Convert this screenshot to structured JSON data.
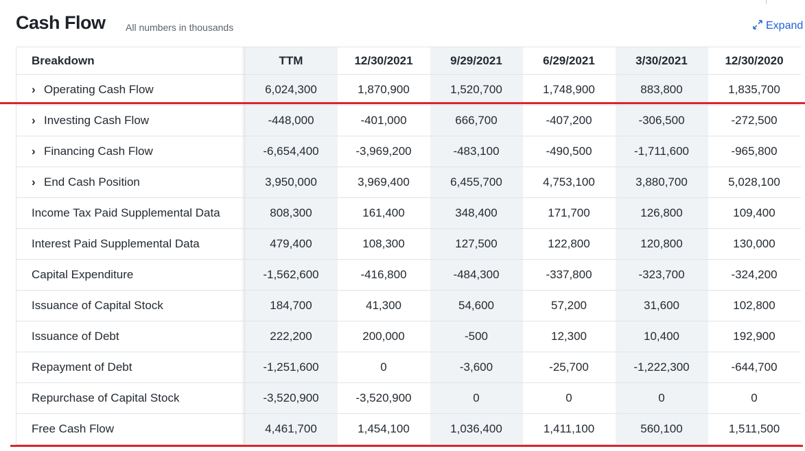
{
  "header": {
    "title": "Cash Flow",
    "subtitle": "All numbers in thousands",
    "expand_label": "Expand"
  },
  "colors": {
    "accent": "#1d5fd6",
    "highlight_line": "#d9262f",
    "shaded_column": "#f0f3f5"
  },
  "table": {
    "columns": [
      "Breakdown",
      "TTM",
      "12/30/2021",
      "9/29/2021",
      "6/29/2021",
      "3/30/2021",
      "12/30/2020"
    ],
    "rows": [
      {
        "label": "Operating Cash Flow",
        "expandable": true,
        "values": [
          "6,024,300",
          "1,870,900",
          "1,520,700",
          "1,748,900",
          "883,800",
          "1,835,700"
        ]
      },
      {
        "label": "Investing Cash Flow",
        "expandable": true,
        "values": [
          "-448,000",
          "-401,000",
          "666,700",
          "-407,200",
          "-306,500",
          "-272,500"
        ]
      },
      {
        "label": "Financing Cash Flow",
        "expandable": true,
        "values": [
          "-6,654,400",
          "-3,969,200",
          "-483,100",
          "-490,500",
          "-1,711,600",
          "-965,800"
        ]
      },
      {
        "label": "End Cash Position",
        "expandable": true,
        "values": [
          "3,950,000",
          "3,969,400",
          "6,455,700",
          "4,753,100",
          "3,880,700",
          "5,028,100"
        ]
      },
      {
        "label": "Income Tax Paid Supplemental Data",
        "expandable": false,
        "values": [
          "808,300",
          "161,400",
          "348,400",
          "171,700",
          "126,800",
          "109,400"
        ]
      },
      {
        "label": "Interest Paid Supplemental Data",
        "expandable": false,
        "values": [
          "479,400",
          "108,300",
          "127,500",
          "122,800",
          "120,800",
          "130,000"
        ]
      },
      {
        "label": "Capital Expenditure",
        "expandable": false,
        "values": [
          "-1,562,600",
          "-416,800",
          "-484,300",
          "-337,800",
          "-323,700",
          "-324,200"
        ]
      },
      {
        "label": "Issuance of Capital Stock",
        "expandable": false,
        "values": [
          "184,700",
          "41,300",
          "54,600",
          "57,200",
          "31,600",
          "102,800"
        ]
      },
      {
        "label": "Issuance of Debt",
        "expandable": false,
        "values": [
          "222,200",
          "200,000",
          "-500",
          "12,300",
          "10,400",
          "192,900"
        ]
      },
      {
        "label": "Repayment of Debt",
        "expandable": false,
        "values": [
          "-1,251,600",
          "0",
          "-3,600",
          "-25,700",
          "-1,222,300",
          "-644,700"
        ]
      },
      {
        "label": "Repurchase of Capital Stock",
        "expandable": false,
        "values": [
          "-3,520,900",
          "-3,520,900",
          "0",
          "0",
          "0",
          "0"
        ]
      },
      {
        "label": "Free Cash Flow",
        "expandable": false,
        "values": [
          "4,461,700",
          "1,454,100",
          "1,036,400",
          "1,411,100",
          "560,100",
          "1,511,500"
        ]
      }
    ]
  }
}
